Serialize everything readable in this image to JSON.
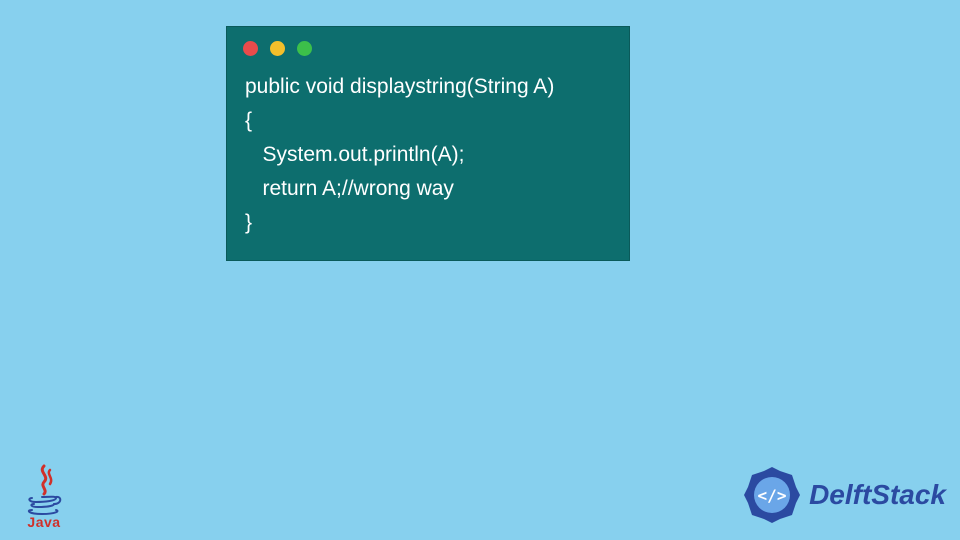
{
  "code_window": {
    "lines": [
      "public void displaystring(String A)",
      "{",
      "   System.out.println(A);",
      "   return A;//wrong way",
      "}"
    ]
  },
  "logos": {
    "java_label": "Java",
    "delft_label": "DelftStack"
  },
  "colors": {
    "background": "#87d0ee",
    "code_bg": "#0d6e6e",
    "code_text": "#ffffff",
    "dot_red": "#e94b4b",
    "dot_yellow": "#f3bf2b",
    "dot_green": "#3cc04a",
    "java_brand": "#d0302a",
    "delft_brand": "#2b4aa1"
  }
}
